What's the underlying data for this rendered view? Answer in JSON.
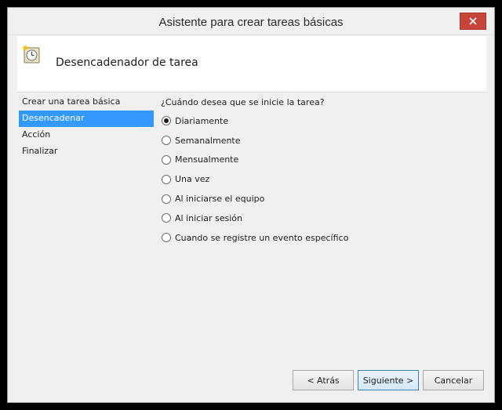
{
  "window": {
    "title": "Asistente para crear tareas básicas",
    "close_glyph": "×"
  },
  "header": {
    "icon": "task-clock-icon",
    "title": "Desencadenador de tarea"
  },
  "sidebar": {
    "items": [
      {
        "label": "Crear una tarea básica",
        "active": false
      },
      {
        "label": "Desencadenar",
        "active": true
      },
      {
        "label": "Acción",
        "active": false
      },
      {
        "label": "Finalizar",
        "active": false
      }
    ]
  },
  "content": {
    "question": "¿Cuándo desea que se inicie la tarea?",
    "options": [
      {
        "label": "Diariamente",
        "checked": true
      },
      {
        "label": "Semanalmente",
        "checked": false
      },
      {
        "label": "Mensualmente",
        "checked": false
      },
      {
        "label": "Una vez",
        "checked": false
      },
      {
        "label": "Al iniciarse el equipo",
        "checked": false
      },
      {
        "label": "Al iniciar sesión",
        "checked": false
      },
      {
        "label": "Cuando se registre un evento específico",
        "checked": false
      }
    ]
  },
  "buttons": {
    "back": "< Atrás",
    "next": "Siguiente >",
    "cancel": "Cancelar"
  },
  "colors": {
    "selection": "#3399ff",
    "close_button": "#c7443a",
    "primary_border": "#3c7fb1"
  }
}
